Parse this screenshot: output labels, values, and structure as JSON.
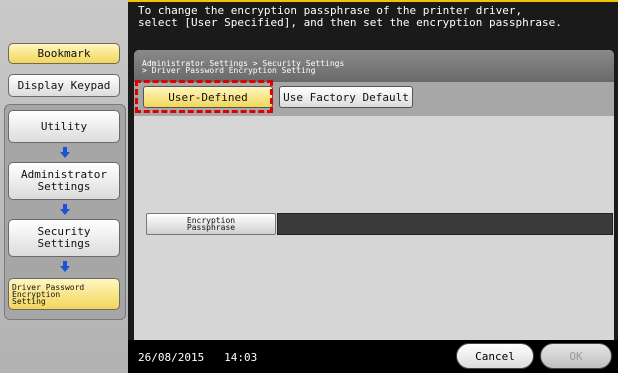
{
  "message": {
    "line1": "To change the encryption passphrase of the printer driver,",
    "line2": "select [User Specified], and then set the encryption passphrase."
  },
  "sidebar": {
    "bookmark_label": "Bookmark",
    "keypad_label": "Display Keypad",
    "nav_items": [
      "Utility",
      "Administrator\nSettings",
      "Security\nSettings",
      "Driver Password\nEncryption\nSetting"
    ]
  },
  "breadcrumb": {
    "line1": "Administrator Settings > Security Settings",
    "line2": "> Driver Password Encryption Setting"
  },
  "tabs": {
    "user_defined": "User-Defined",
    "factory_default": "Use Factory Default"
  },
  "fields": {
    "passphrase_label": "Encryption\nPassphrase",
    "passphrase_value": ""
  },
  "footer": {
    "date": "26/08/2015",
    "time": "14:03",
    "cancel_label": "Cancel",
    "ok_label": "OK"
  },
  "colors": {
    "accent": "#f2d65a",
    "highlight_outline": "#e00000",
    "arrow": "#1a52d8"
  }
}
